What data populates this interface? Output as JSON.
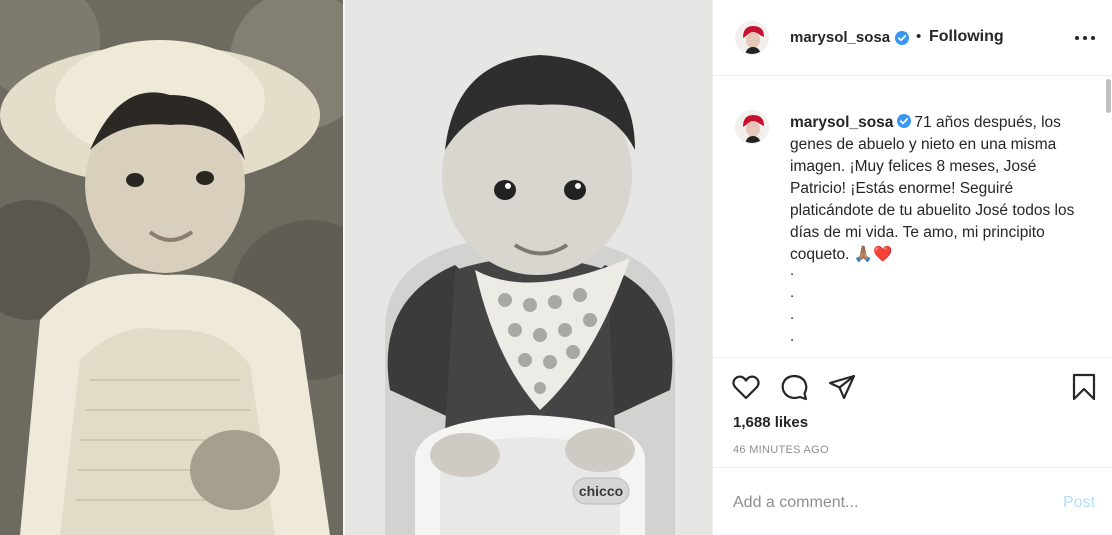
{
  "post": {
    "image_left_alt": "",
    "image_right_alt": "",
    "image_right_logo": "chicco"
  },
  "header": {
    "username": "marysol_sosa",
    "separator": "•",
    "follow_status": "Following",
    "verified_icon": "verified-badge-icon",
    "more_icon": "more-options-icon"
  },
  "caption": {
    "username": "marysol_sosa",
    "text": "71 años después, los genes de abuelo y nieto en una misma imagen. ¡Muy felices 8 meses, José Patricio! ¡Estás enorme! Seguiré platicándote de tu abuelito José todos los días de mi vida. Te amo, mi principito coqueto. ",
    "emoji": "🙏🏽❤️",
    "dots": [
      ".",
      ".",
      ".",
      "."
    ]
  },
  "actions": {
    "like_icon": "heart-icon",
    "comment_icon": "comment-icon",
    "share_icon": "share-icon",
    "save_icon": "bookmark-icon",
    "likes": "1,688 likes",
    "time_ago": "46 MINUTES AGO"
  },
  "comment": {
    "placeholder": "Add a comment...",
    "post_label": "Post"
  },
  "colors": {
    "accent": "#0095f6",
    "post_disabled": "#b2dffc",
    "text": "#262626",
    "muted": "#8e8e8e",
    "verified": "#3897f0",
    "heart": "#e0245e"
  }
}
